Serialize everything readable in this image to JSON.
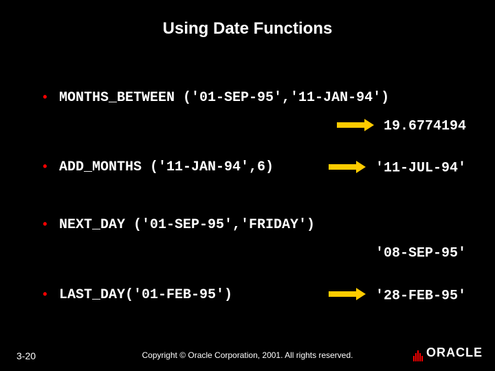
{
  "title": "Using Date Functions",
  "items": [
    {
      "fn": "MONTHS_BETWEEN ('01-SEP-95','11-JAN-94')",
      "result": "19.6774194",
      "layout": "below"
    },
    {
      "fn": "ADD_MONTHS ('11-JAN-94',6)",
      "result": "'11-JUL-94'",
      "layout": "inline"
    },
    {
      "fn": "NEXT_DAY ('01-SEP-95','FRIDAY')",
      "result": "'08-SEP-95'",
      "layout": "below"
    },
    {
      "fn": "LAST_DAY('01-FEB-95')",
      "result": "'28-FEB-95'",
      "layout": "inline"
    }
  ],
  "footer": {
    "page": "3-20",
    "copyright": "Copyright © Oracle Corporation, 2001. All rights reserved.",
    "logo": "ORACLE"
  }
}
